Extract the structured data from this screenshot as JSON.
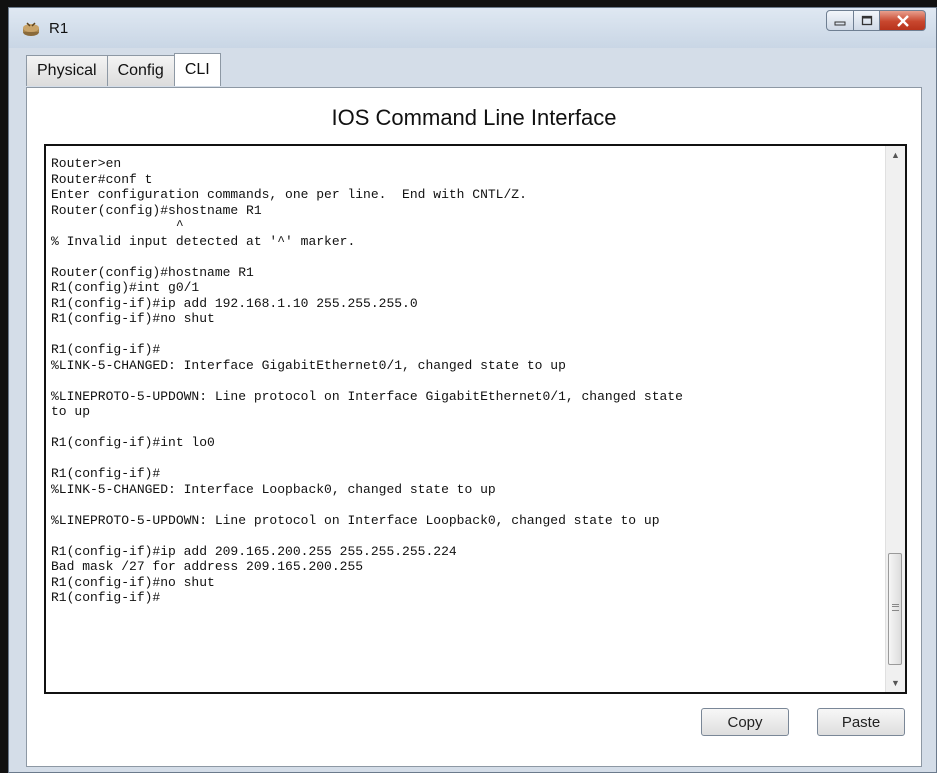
{
  "window": {
    "title": "R1",
    "app_icon": "packet-tracer-router-icon",
    "controls": {
      "minimize": "minimize-icon",
      "maximize": "maximize-icon",
      "close": "close-icon"
    }
  },
  "tabs": [
    {
      "label": "Physical",
      "active": false
    },
    {
      "label": "Config",
      "active": false
    },
    {
      "label": "CLI",
      "active": true
    }
  ],
  "cli": {
    "heading": "IOS Command Line Interface",
    "output": "Router>en\nRouter#conf t\nEnter configuration commands, one per line.  End with CNTL/Z.\nRouter(config)#shostname R1\n                ^\n% Invalid input detected at '^' marker.\n\nRouter(config)#hostname R1\nR1(config)#int g0/1\nR1(config-if)#ip add 192.168.1.10 255.255.255.0\nR1(config-if)#no shut\n\nR1(config-if)#\n%LINK-5-CHANGED: Interface GigabitEthernet0/1, changed state to up\n\n%LINEPROTO-5-UPDOWN: Line protocol on Interface GigabitEthernet0/1, changed state\nto up\n\nR1(config-if)#int lo0\n\nR1(config-if)#\n%LINK-5-CHANGED: Interface Loopback0, changed state to up\n\n%LINEPROTO-5-UPDOWN: Line protocol on Interface Loopback0, changed state to up\n\nR1(config-if)#ip add 209.165.200.255 255.255.255.224\nBad mask /27 for address 209.165.200.255\nR1(config-if)#no shut\nR1(config-if)#"
  },
  "buttons": {
    "copy": "Copy",
    "paste": "Paste"
  }
}
